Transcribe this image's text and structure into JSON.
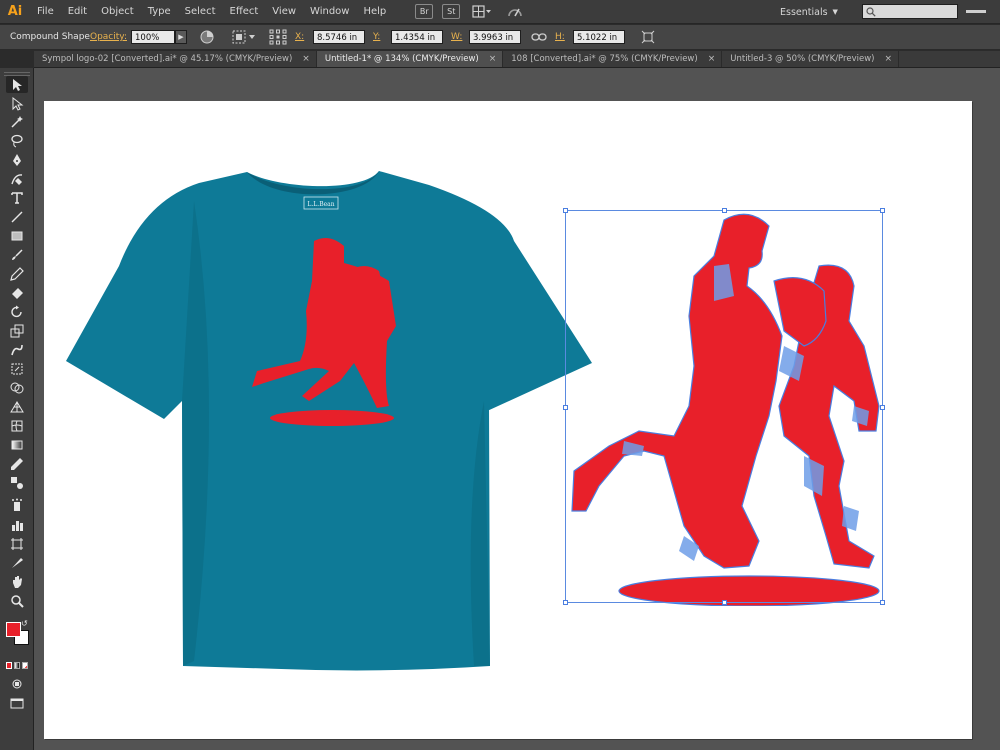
{
  "app": {
    "logo": "Ai"
  },
  "menu": {
    "items": [
      "File",
      "Edit",
      "Object",
      "Type",
      "Select",
      "Effect",
      "View",
      "Window",
      "Help"
    ],
    "bridge_label": "Br",
    "stock_label": "St",
    "workspace": "Essentials"
  },
  "control": {
    "selection_type": "Compound Shape",
    "opacity_label": "Opacity:",
    "opacity_value": "100%",
    "x_label": "X:",
    "x_value": "8.5746 in",
    "y_label": "Y:",
    "y_value": "1.4354 in",
    "w_label": "W:",
    "w_value": "3.9963 in",
    "h_label": "H:",
    "h_value": "5.1022 in"
  },
  "tabs": [
    {
      "label": "Sympol logo-02 [Converted].ai* @ 45.17% (CMYK/Preview)",
      "active": false
    },
    {
      "label": "Untitled-1* @ 134% (CMYK/Preview)",
      "active": true
    },
    {
      "label": "108 [Converted].ai* @ 75% (CMYK/Preview)",
      "active": false
    },
    {
      "label": "Untitled-3 @ 50% (CMYK/Preview)",
      "active": false
    }
  ],
  "tab_close_glyph": "×",
  "artwork": {
    "shirt_color": "#0e7a97",
    "print_color": "#e8202a",
    "label_text": "L.L.Bean"
  },
  "colors": {
    "fill": "#e8202a",
    "stroke": "#ffffff",
    "selection": "#4a7ee0"
  }
}
